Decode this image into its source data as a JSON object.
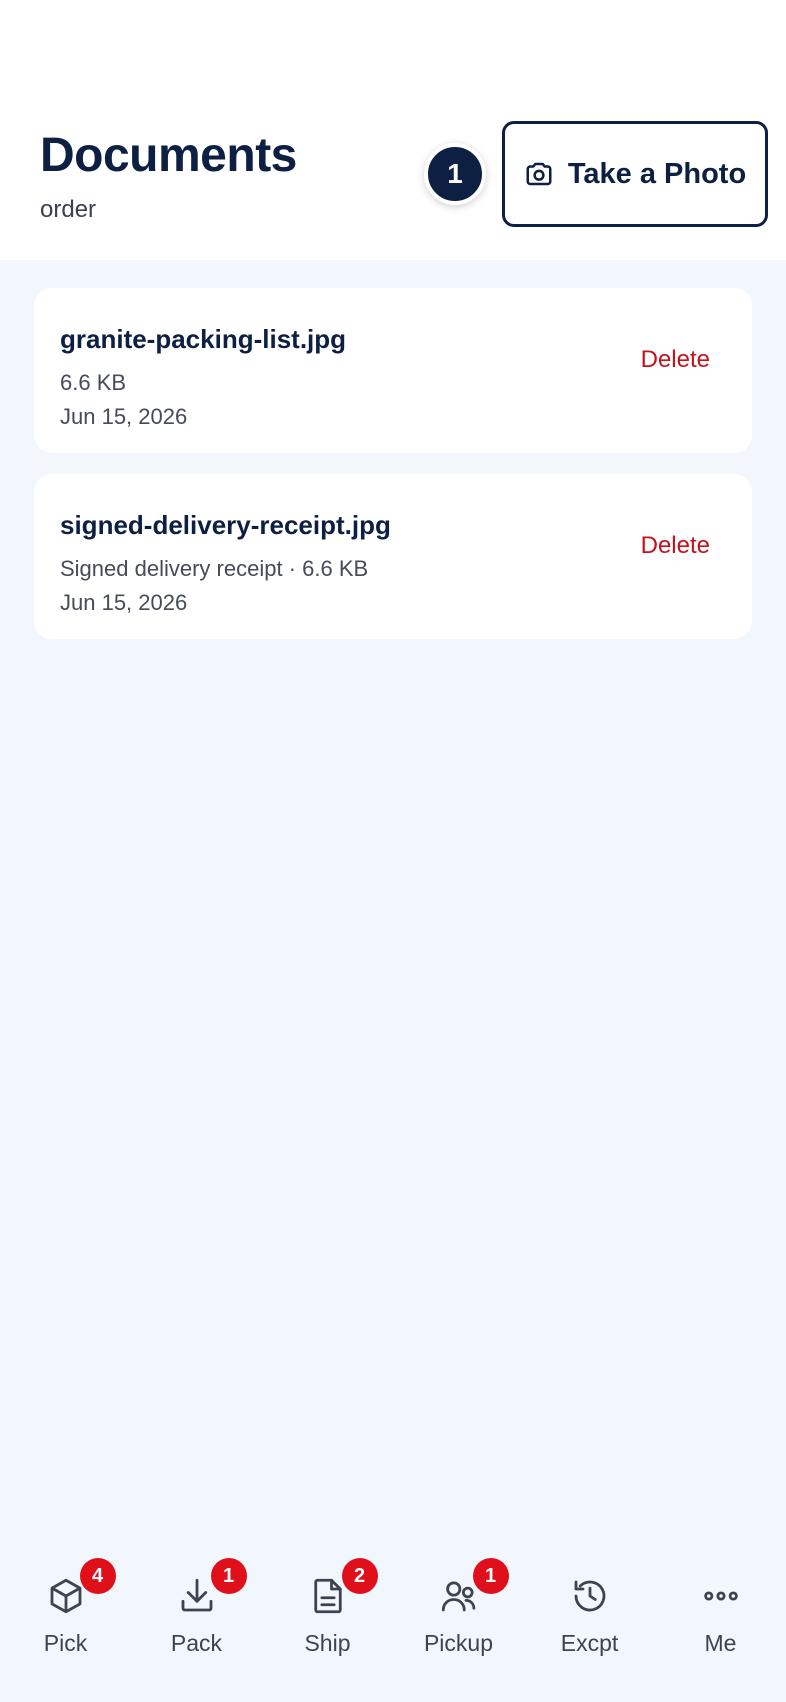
{
  "header": {
    "title": "Documents",
    "subtitle": "order",
    "count": "1",
    "take_photo_label": "Take a Photo"
  },
  "documents": [
    {
      "name": "granite-packing-list.jpg",
      "meta": "6.6 KB",
      "date": "Jun 15, 2026",
      "delete_label": "Delete"
    },
    {
      "name": "signed-delivery-receipt.jpg",
      "meta": "Signed delivery receipt · 6.6 KB",
      "date": "Jun 15, 2026",
      "delete_label": "Delete"
    }
  ],
  "nav": {
    "items": [
      {
        "label": "Pick",
        "icon": "box-icon",
        "badge": "4"
      },
      {
        "label": "Pack",
        "icon": "download-icon",
        "badge": "1"
      },
      {
        "label": "Ship",
        "icon": "document-icon",
        "badge": "2"
      },
      {
        "label": "Pickup",
        "icon": "users-icon",
        "badge": "1"
      },
      {
        "label": "Excpt",
        "icon": "history-icon",
        "badge": ""
      },
      {
        "label": "Me",
        "icon": "more-icon",
        "badge": ""
      }
    ]
  },
  "colors": {
    "primary": "#0d1f42",
    "danger": "#c4131d",
    "badge": "#e0101b",
    "background": "#f1f7fd"
  }
}
